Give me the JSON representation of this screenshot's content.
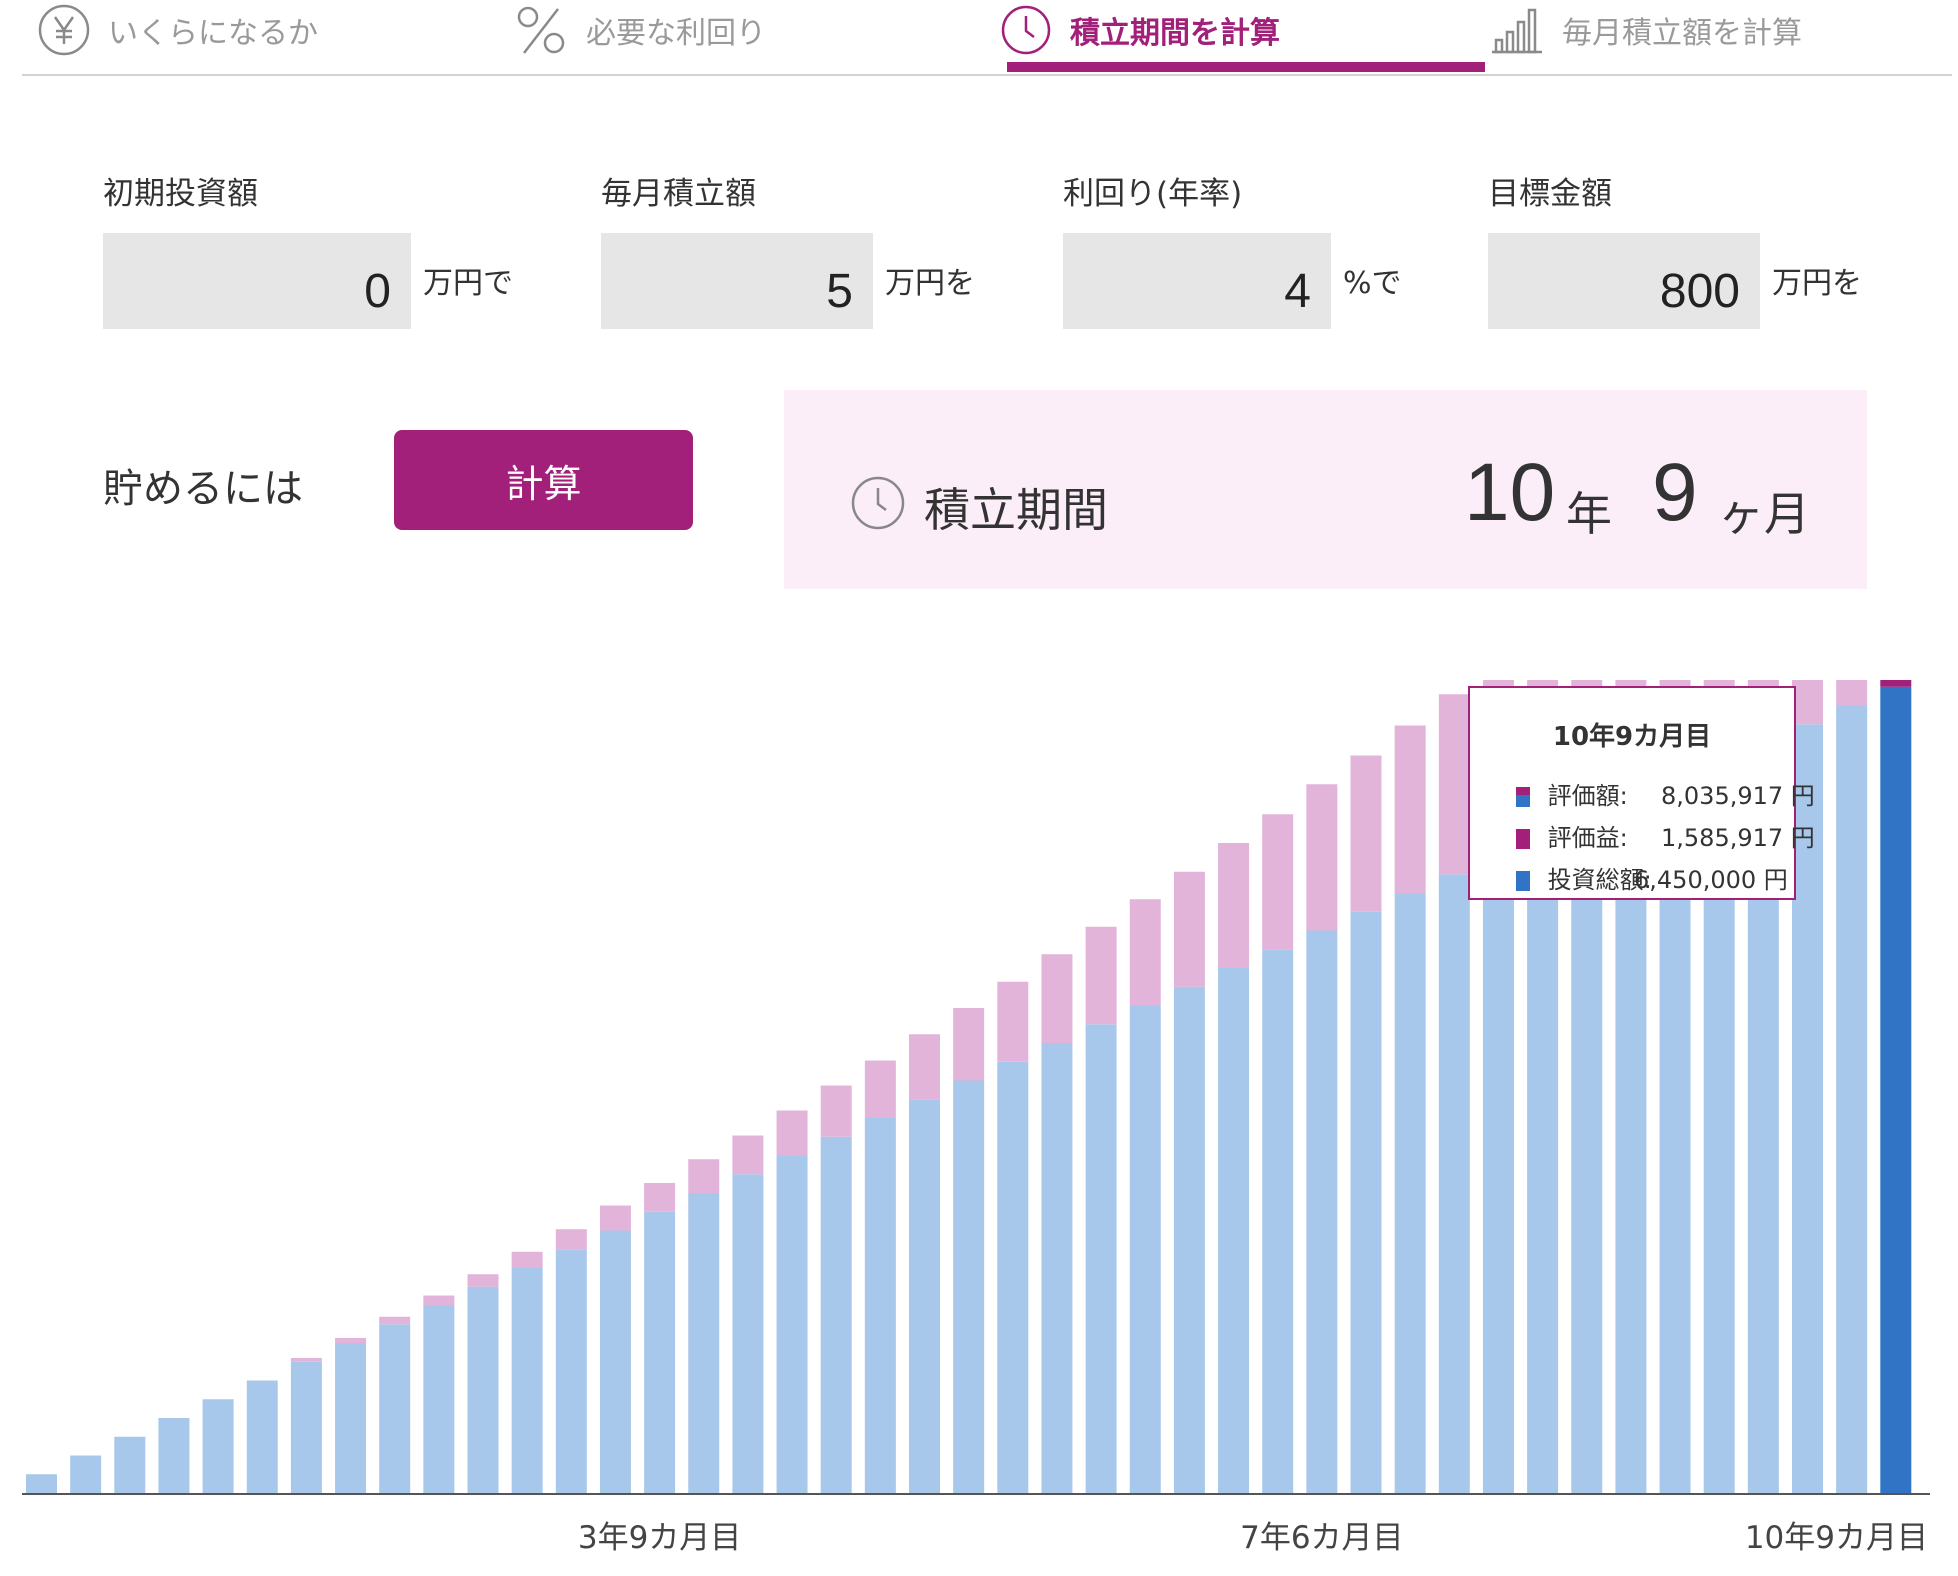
{
  "tabs": [
    {
      "label": "いくらになるか",
      "icon": "yen-circle-icon",
      "active": false
    },
    {
      "label": "必要な利回り",
      "icon": "percent-icon",
      "active": false
    },
    {
      "label": "積立期間を計算",
      "icon": "clock-icon",
      "active": true
    },
    {
      "label": "毎月積立額を計算",
      "icon": "bar-chart-icon",
      "active": false
    }
  ],
  "form": {
    "initial": {
      "label": "初期投資額",
      "value": "0",
      "unit": "万円で"
    },
    "monthly": {
      "label": "毎月積立額",
      "value": "5",
      "unit": "万円を"
    },
    "rate": {
      "label": "利回り(年率)",
      "value": "4",
      "unit": "%で"
    },
    "target": {
      "label": "目標金額",
      "value": "800",
      "unit": "万円を"
    }
  },
  "action": {
    "prefix": "貯めるには",
    "button": "計算"
  },
  "result": {
    "label": "積立期間",
    "years": "10",
    "years_unit": "年",
    "months": "9",
    "months_unit": "ヶ月"
  },
  "colors": {
    "accent": "#a3207a",
    "principal": "#a8c8eb",
    "gain": "#e2b4da",
    "principal_highlight": "#3174c6",
    "gain_highlight": "#a3207a",
    "result_bg": "#fbeef8",
    "input_bg": "#e6e6e6"
  },
  "tooltip": {
    "title": "10年9カ月目",
    "rows": [
      {
        "label": "評価額:",
        "value": "8,035,917 円"
      },
      {
        "label": "評価益:",
        "value": "1,585,917 円"
      },
      {
        "label": "投資総額:",
        "value": "6,450,000 円"
      }
    ]
  },
  "chart_data": {
    "type": "bar",
    "stacked": true,
    "x_tick_labels": [
      "3年9カ月目",
      "7年6カ月目",
      "10年9カ月目"
    ],
    "x_tick_indices": [
      14,
      29,
      42
    ],
    "highlight_index": 42,
    "ylim": [
      0,
      9600000
    ],
    "series": [
      {
        "name": "投資総額",
        "values": [
          150000,
          300000,
          450000,
          600000,
          750000,
          900000,
          1050000,
          1200000,
          1350000,
          1500000,
          1650000,
          1800000,
          1950000,
          2100000,
          2250000,
          2400000,
          2550000,
          2700000,
          2850000,
          3000000,
          3150000,
          3300000,
          3450000,
          3600000,
          3750000,
          3900000,
          4050000,
          4200000,
          4350000,
          4500000,
          4650000,
          4800000,
          4950000,
          5100000,
          5250000,
          5400000,
          5550000,
          5700000,
          5850000,
          6000000,
          6150000,
          6300000,
          6450000
        ]
      },
      {
        "name": "評価益",
        "values": [
          0,
          0,
          0,
          0,
          0,
          0,
          30000,
          40000,
          60000,
          80000,
          100000,
          130000,
          160000,
          200000,
          230000,
          270000,
          310000,
          360000,
          410000,
          460000,
          520000,
          580000,
          640000,
          710000,
          780000,
          850000,
          920000,
          1000000,
          1080000,
          1170000,
          1250000,
          1340000,
          1440000,
          1530000,
          1630000,
          1730000,
          1830000,
          1950000,
          2060000,
          2170000,
          2290000,
          2420000,
          1585917
        ]
      }
    ]
  }
}
